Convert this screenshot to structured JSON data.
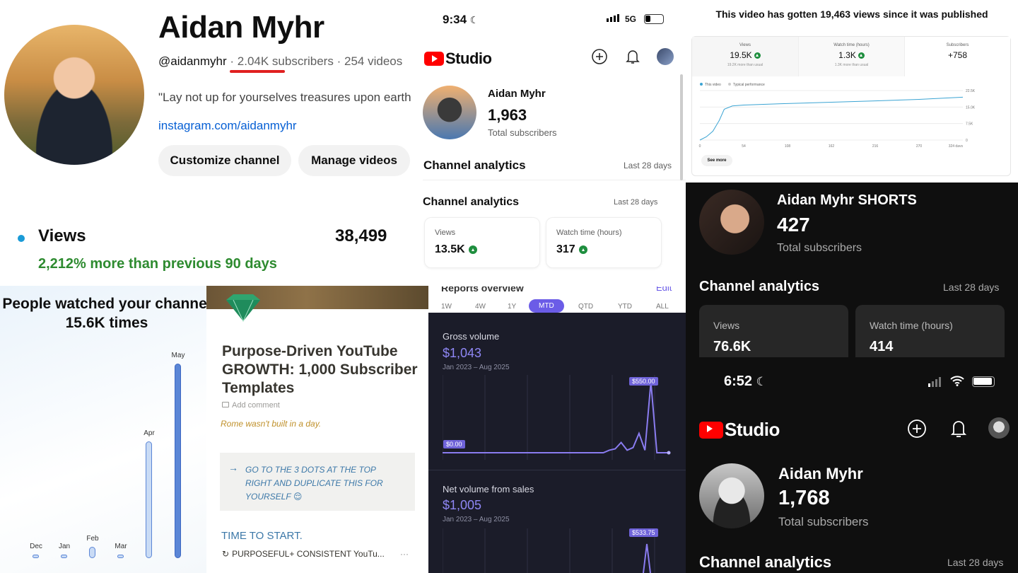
{
  "channel": {
    "name": "Aidan Myhr",
    "handle": "@aidanmyhr",
    "sep1": "·",
    "subscribers": "2.04K subscribers",
    "sep2": "·",
    "videos": "254 videos",
    "bio": "\"Lay not up for yourselves treasures upon earth",
    "link": "instagram.com/aidanmyhr",
    "customize_label": "Customize channel",
    "manage_label": "Manage videos"
  },
  "views_card": {
    "label": "Views",
    "value": "38,499",
    "change": "2,212% more than previous 90 days"
  },
  "studio_light": {
    "time": "9:34",
    "carrier": "5G",
    "logo_text": "Studio",
    "channel_name": "Aidan Myhr",
    "subscribers": "1,963",
    "subscribers_label": "Total subscribers",
    "analytics_title_1": "Channel analytics",
    "period_1": "Last 28 days",
    "analytics_title_2": "Channel analytics",
    "period_2": "Last 28 days",
    "cards": [
      {
        "label": "Views",
        "value": "13.5K"
      },
      {
        "label": "Watch time (hours)",
        "value": "317"
      }
    ]
  },
  "video_summary": {
    "headline": "This video has gotten 19,463 views since it was published",
    "tabs": [
      {
        "label": "Views",
        "value": "19.5K",
        "note": "19.2K more than usual"
      },
      {
        "label": "Watch time (hours)",
        "value": "1.3K",
        "note": "1.3K more than usual"
      },
      {
        "label": "Subscribers",
        "value": "+758",
        "note": ""
      }
    ],
    "legend_this": "This video",
    "legend_typical": "Typical performance",
    "see_more": "See more"
  },
  "video_chart": {
    "type": "line",
    "x": [
      0,
      8,
      16,
      24,
      30,
      40,
      54,
      100,
      162,
      216,
      270,
      324
    ],
    "y": [
      0,
      1500,
      4000,
      9000,
      14000,
      15500,
      15900,
      16500,
      17200,
      17800,
      18500,
      19500
    ],
    "xticks": [
      "0",
      "54",
      "108",
      "162",
      "216",
      "270",
      "324 days"
    ],
    "yticks": [
      "0",
      "7.5K",
      "15.0K",
      "22.5K"
    ],
    "xlim": [
      0,
      324
    ],
    "ylim": [
      0,
      22500
    ],
    "color": "#3ba4d3"
  },
  "shorts": {
    "channel_name": "Aidan Myhr SHORTS",
    "subscribers": "427",
    "subscribers_label": "Total subscribers",
    "analytics_title": "Channel analytics",
    "period": "Last 28 days",
    "cards": [
      {
        "label": "Views",
        "value": "76.6K"
      },
      {
        "label": "Watch time (hours)",
        "value": "414"
      }
    ]
  },
  "studio_dark": {
    "time": "6:52",
    "logo_text": "Studio",
    "channel_name": "Aidan Myhr",
    "subscribers": "1,768",
    "subscribers_label": "Total subscribers",
    "analytics_title": "Channel analytics",
    "period": "Last 28 days"
  },
  "people_watched": {
    "headline": "People watched your channel 15.6K times",
    "chart_data": {
      "type": "bar",
      "categories": [
        "Dec",
        "Jan",
        "Feb",
        "Mar",
        "Apr",
        "May"
      ],
      "values": [
        0.02,
        0.02,
        0.06,
        0.02,
        0.6,
        1.0
      ],
      "highlight": "May"
    }
  },
  "notion": {
    "title": "Purpose-Driven YouTube GROWTH: 1,000 Subscriber Templates",
    "add_comment": "Add comment",
    "tagline": "Rome wasn't built in a day.",
    "callout": "GO TO THE 3 DOTS AT THE TOP RIGHT AND DUPLICATE THIS FOR YOURSELF",
    "callout_emoji": "😌",
    "start": "TIME TO START.",
    "item": "PURPOSEFUL+ CONSISTENT YouTu...",
    "more": "···"
  },
  "sales": {
    "reports_title": "Reports overview",
    "edit": "Edit",
    "ranges": [
      "1W",
      "4W",
      "1Y",
      "MTD",
      "QTD",
      "YTD",
      "ALL"
    ],
    "active_range": "MTD",
    "gross_label": "Gross volume",
    "gross_value": "$1,043",
    "gross_dates": "Jan 2023 – Aug 2025",
    "gross_max_tag": "$550.00",
    "gross_zero_tag": "$0.00",
    "net_label": "Net volume from sales",
    "net_value": "$1,005",
    "net_dates": "Jan 2023 – Aug 2025",
    "net_max_tag": "$533.75",
    "chart_data": {
      "type": "line",
      "gross_values": [
        0,
        0,
        0,
        0,
        0,
        0,
        0,
        0,
        0,
        0,
        0,
        0,
        0,
        0,
        0,
        0,
        0,
        0,
        0,
        0,
        0,
        0,
        0,
        0,
        0,
        0,
        0,
        0,
        20,
        30,
        80,
        20,
        40,
        150,
        20,
        550,
        0,
        0,
        0
      ],
      "color": "#8a7cf0"
    }
  }
}
